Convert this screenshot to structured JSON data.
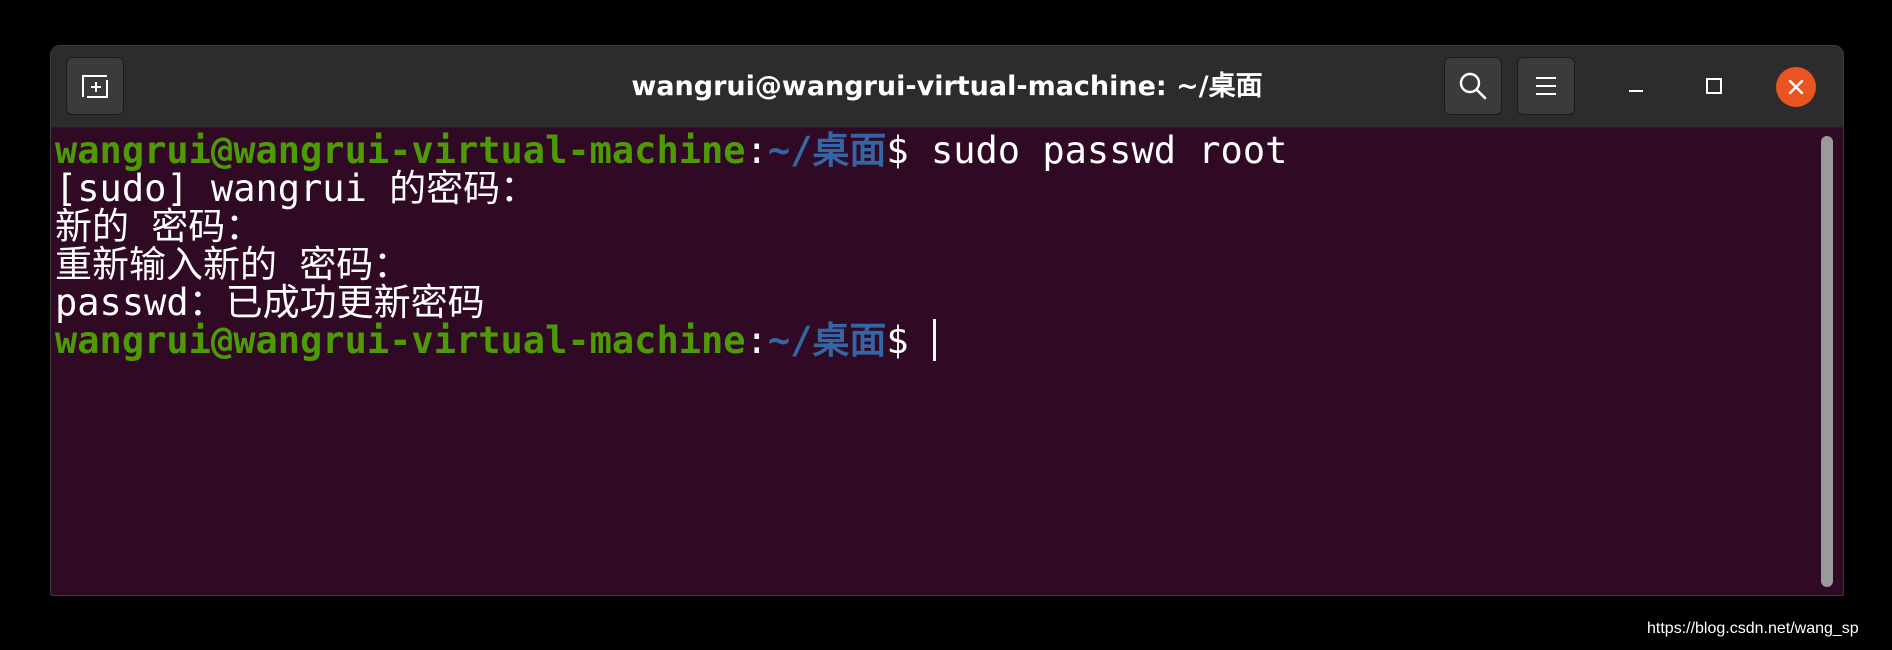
{
  "window": {
    "title": "wangrui@wangrui-virtual-machine: ~/桌面"
  },
  "titlebar": {
    "new_tab_icon": "new-tab-icon",
    "search_icon": "search-icon",
    "menu_icon": "hamburger-menu-icon",
    "minimize_icon": "minimize-icon",
    "maximize_icon": "maximize-icon",
    "close_icon": "close-icon",
    "close_color": "#e95420"
  },
  "terminal": {
    "colors": {
      "background": "#300a24",
      "user": "#4e9a06",
      "path": "#3465a4",
      "text": "#ffffff"
    },
    "lines": [
      {
        "user": "wangrui@wangrui-virtual-machine",
        "sep": ":",
        "path": "~/桌面",
        "prompt": "$ ",
        "command": "sudo passwd root"
      },
      {
        "text": "[sudo] wangrui 的密码："
      },
      {
        "text": "新的 密码："
      },
      {
        "text": "重新输入新的 密码："
      },
      {
        "text": "passwd：已成功更新密码"
      },
      {
        "user": "wangrui@wangrui-virtual-machine",
        "sep": ":",
        "path": "~/桌面",
        "prompt": "$ ",
        "command": ""
      }
    ]
  },
  "watermark": "https://blog.csdn.net/wang_sp"
}
